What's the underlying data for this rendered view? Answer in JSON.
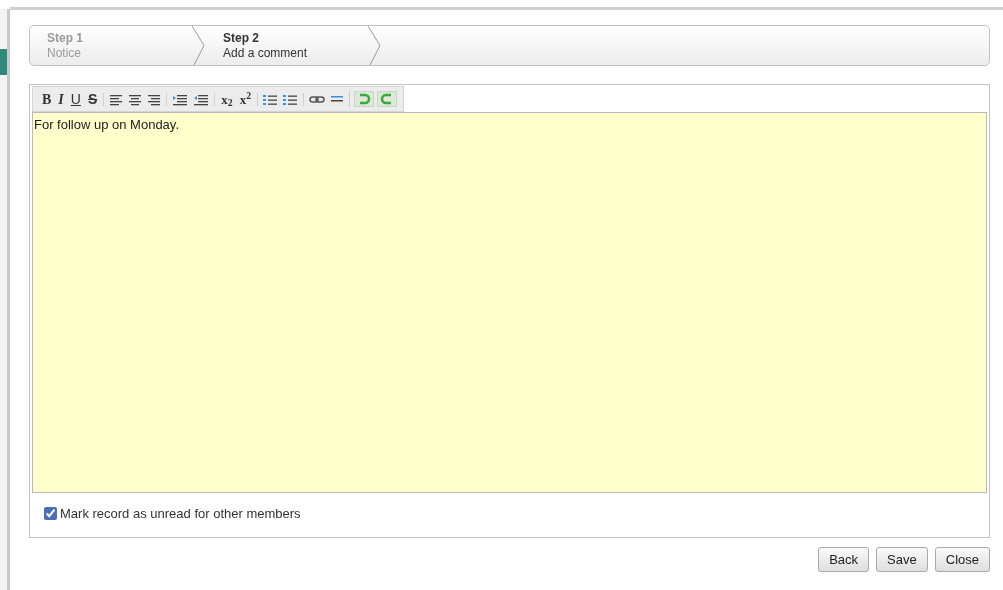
{
  "steps": [
    {
      "title": "Step 1",
      "subtitle": "Notice",
      "selected": false
    },
    {
      "title": "Step 2",
      "subtitle": "Add a comment",
      "selected": true
    }
  ],
  "toolbar": [
    [
      {
        "kind": "bold",
        "label": "B"
      },
      {
        "kind": "italic",
        "label": "I"
      },
      {
        "kind": "underline",
        "label": "U"
      },
      {
        "kind": "strike",
        "label": "S"
      }
    ],
    [
      {
        "kind": "align-left"
      },
      {
        "kind": "align-center"
      },
      {
        "kind": "align-right"
      }
    ],
    [
      {
        "kind": "indent"
      },
      {
        "kind": "outdent"
      }
    ],
    [
      {
        "kind": "script",
        "label": "x$_{2}$"
      },
      {
        "kind": "script",
        "label": "x$^{2}$"
      }
    ],
    [
      {
        "kind": "ordered-list"
      },
      {
        "kind": "bullet-list"
      }
    ],
    [
      {
        "kind": "link"
      },
      {
        "kind": "rule"
      }
    ],
    [
      {
        "kind": "undo"
      },
      {
        "kind": "redo"
      }
    ]
  ],
  "editor": {
    "value": "For follow up on Monday."
  },
  "mark_unread": {
    "label": "Mark record as unread for other members",
    "checked": true
  },
  "buttons": [
    "Back",
    "Save",
    "Close"
  ]
}
